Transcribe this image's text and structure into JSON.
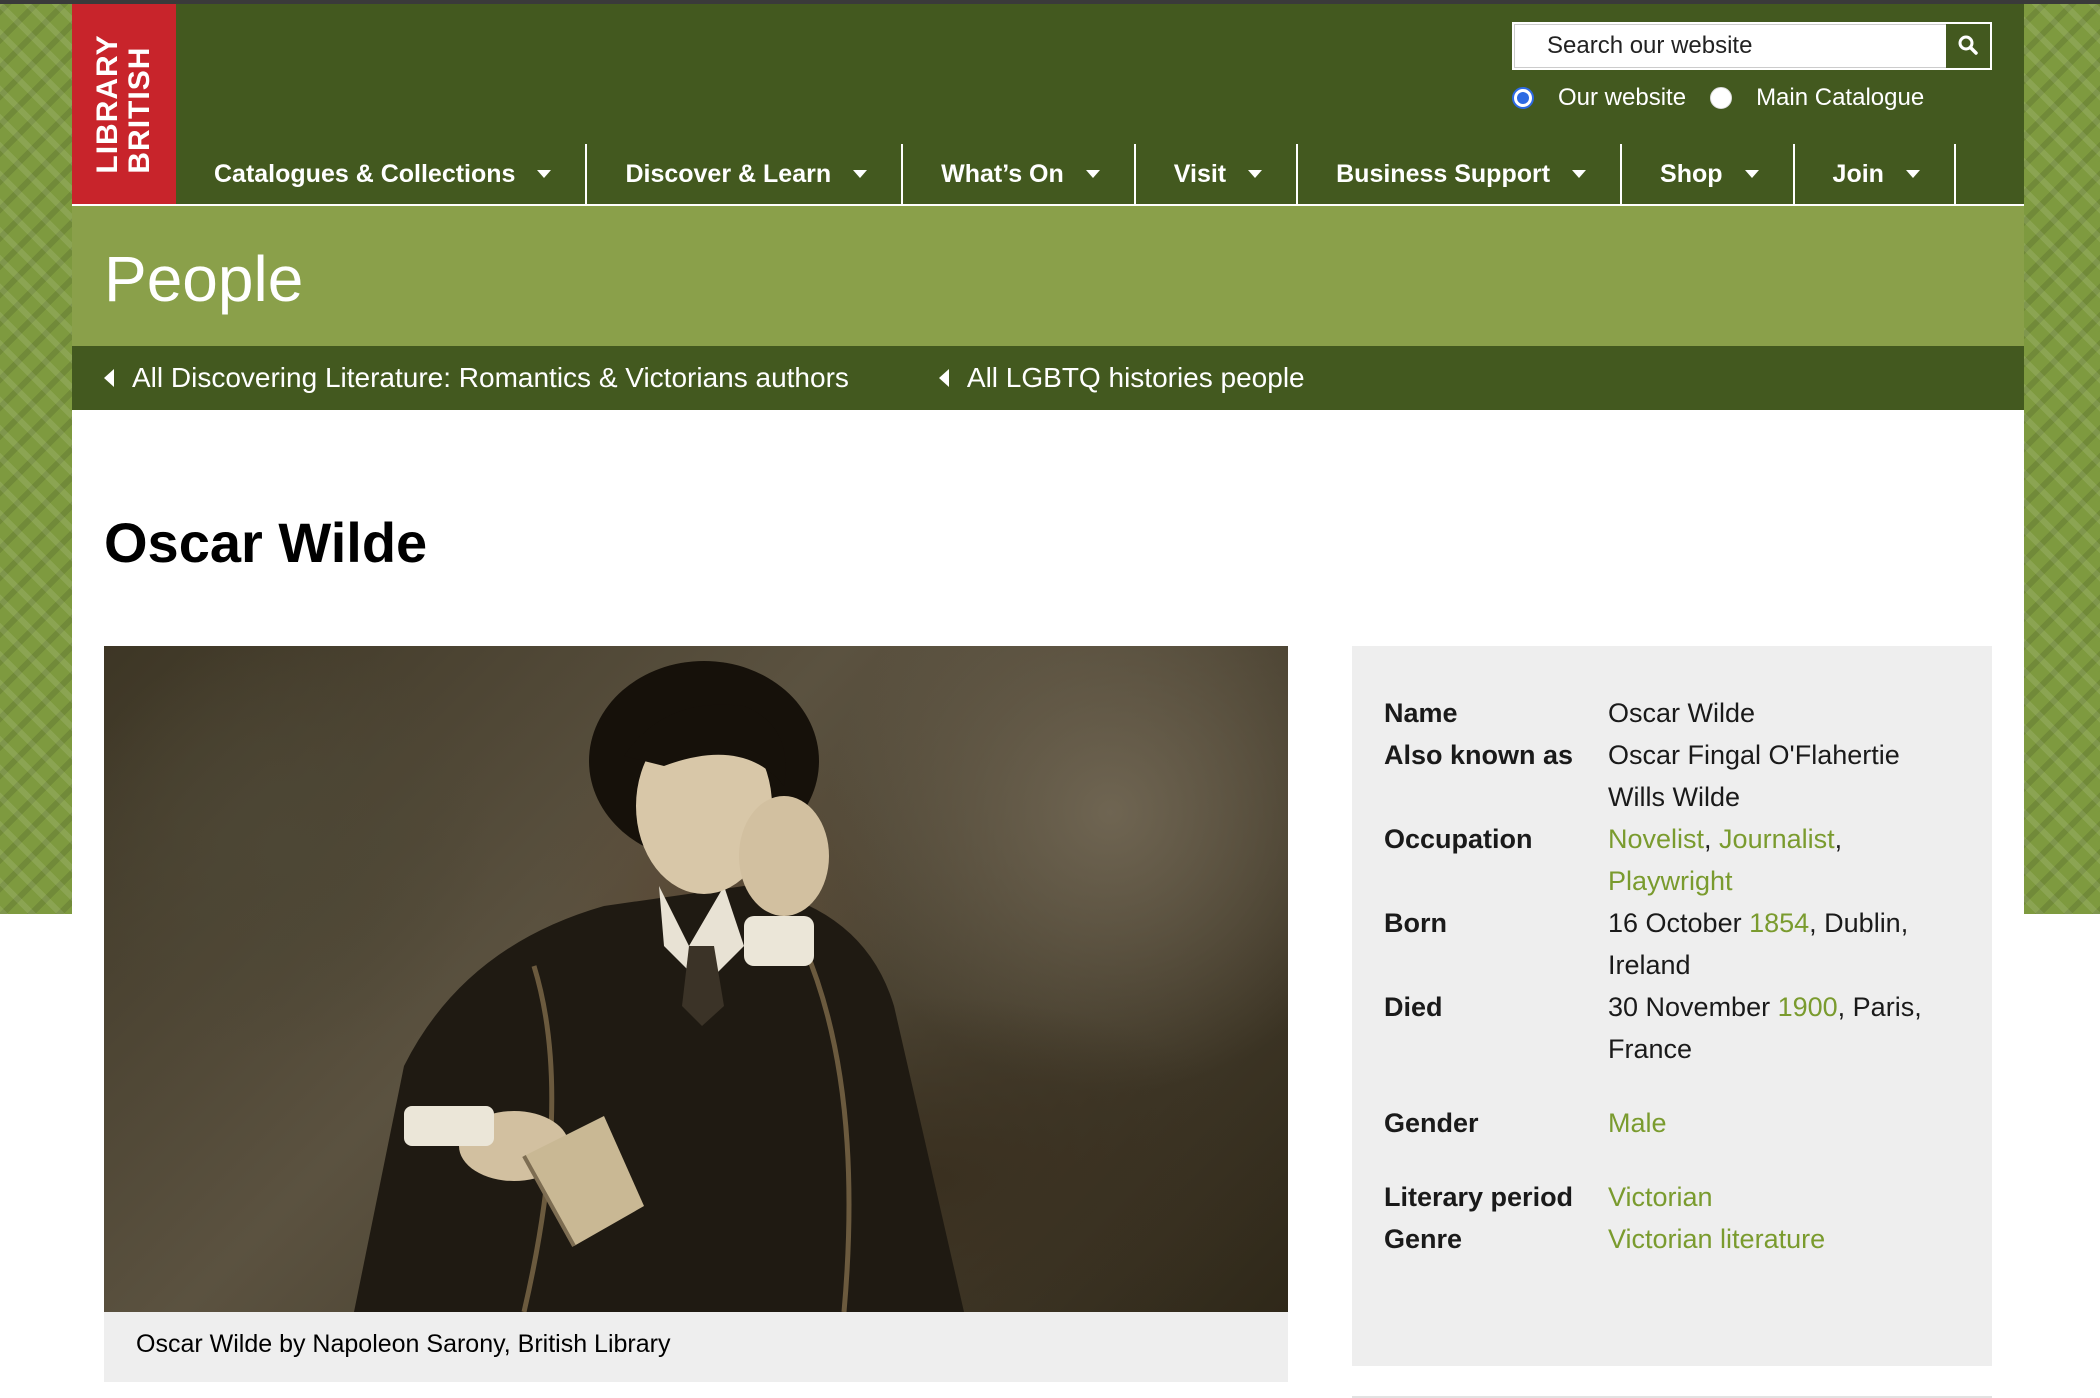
{
  "brand": {
    "logo_line1": "LIBRARY",
    "logo_line2": "BRITISH",
    "colors": {
      "header": "#43591f",
      "banner": "#8aa04a",
      "logo": "#c8242b",
      "link": "#7a9b2e"
    }
  },
  "search": {
    "placeholder": "Search our website",
    "button_icon": "search-icon",
    "options": [
      {
        "label": "Our website",
        "checked": true
      },
      {
        "label": "Main Catalogue",
        "checked": false
      }
    ]
  },
  "nav": {
    "items": [
      {
        "label": "Catalogues & Collections"
      },
      {
        "label": "Discover & Learn"
      },
      {
        "label": "What’s On"
      },
      {
        "label": "Visit"
      },
      {
        "label": "Business Support"
      },
      {
        "label": "Shop"
      },
      {
        "label": "Join"
      }
    ]
  },
  "banner": {
    "title": "People"
  },
  "subnav": {
    "links": [
      {
        "label": "All Discovering Literature: Romantics & Victorians authors"
      },
      {
        "label": "All LGBTQ histories people"
      }
    ]
  },
  "main": {
    "title": "Oscar Wilde",
    "image_caption": "Oscar Wilde by Napoleon Sarony, British Library"
  },
  "info": {
    "name_label": "Name",
    "name_value": "Oscar Wilde",
    "aka_label": "Also known as",
    "aka_value": "Oscar Fingal O'Flahertie Wills Wilde",
    "occupation_label": "Occupation",
    "occupations": [
      "Novelist",
      "Journalist",
      "Playwright"
    ],
    "born_label": "Born",
    "born_date": "16 October ",
    "born_year": "1854",
    "born_place": ", Dublin, Ireland",
    "died_label": "Died",
    "died_date": "30 November ",
    "died_year": "1900",
    "died_place": ", Paris, France",
    "gender_label": "Gender",
    "gender_value": "Male",
    "period_label": "Literary period",
    "period_value": "Victorian",
    "genre_label": "Genre",
    "genre_value": "Victorian literature"
  }
}
